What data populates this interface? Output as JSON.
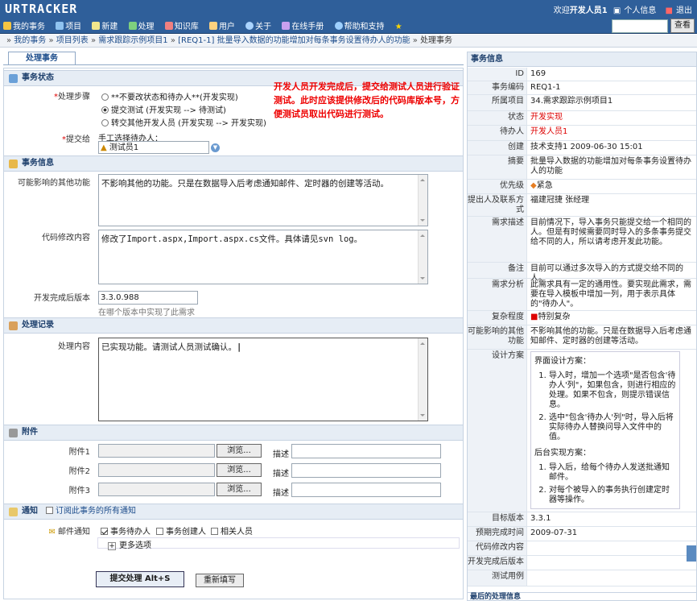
{
  "app": {
    "logo": "URTRACKER",
    "welcome_prefix": "欢迎",
    "user": "开发人员1",
    "profile": "个人信息",
    "logout": "退出",
    "search_button": "查看",
    "nav": [
      "我的事务",
      "项目",
      "新建",
      "处理",
      "知识库",
      "用户",
      "关于",
      "在线手册",
      "帮助和支持"
    ]
  },
  "breadcrumb": [
    "我的事务",
    "项目列表",
    "需求跟踪示例项目1",
    "[REQ1-1] 批量导入数据的功能增加对每条事务设置待办人的功能",
    "处理事务"
  ],
  "tab": "处理事务",
  "annotation": "开发人员开发完成后，提交给测试人员进行验证测试。此时应该提供修改后的代码库版本号，方便测试员取出代码进行测试。",
  "status_section": {
    "title": "事务状态",
    "step_label": "处理步骤",
    "options": [
      "**不要改状态和待办人**(开发实现)",
      "提交测试 (开发实现 --> 待测试)",
      "转交其他开发人员 (开发实现 --> 开发实现)"
    ],
    "submit_to_label": "提交给",
    "manual_pick": "手工选择待办人：",
    "assignee": "测试员1"
  },
  "info_section": {
    "title": "事务信息",
    "impact_label": "可能影响的其他功能",
    "impact_value": "不影响其他的功能。只是在数据导入后考虑通知邮件、定时器的创建等活动。",
    "code_label": "代码修改内容",
    "code_value": "修改了Import.aspx,Import.aspx.cs文件。具体请见svn log。",
    "version_label": "开发完成后版本",
    "version_value": "3.3.0.988",
    "version_hint": "在哪个版本中实现了此需求"
  },
  "record_section": {
    "title": "处理记录",
    "content_label": "处理内容",
    "content_value": "已实现功能。请测试人员测试确认。"
  },
  "attach_section": {
    "title": "附件",
    "rows": [
      {
        "label": "附件1",
        "browse": "浏览...",
        "desc": "描述"
      },
      {
        "label": "附件2",
        "browse": "浏览...",
        "desc": "描述"
      },
      {
        "label": "附件3",
        "browse": "浏览...",
        "desc": "描述"
      }
    ]
  },
  "notify_section": {
    "title": "通知",
    "subscribe": "订阅此事务的所有通知",
    "mail_label": "邮件通知",
    "checks": [
      {
        "label": "事务待办人",
        "checked": true
      },
      {
        "label": "事务创建人",
        "checked": false
      },
      {
        "label": "相关人员",
        "checked": false
      }
    ],
    "more": "更多选项"
  },
  "buttons": {
    "submit": "提交处理 Alt+S",
    "reset": "重新填写"
  },
  "info_panel": {
    "title": "事务信息",
    "rows": [
      {
        "k": "ID",
        "v": "169"
      },
      {
        "k": "事务编码",
        "v": "REQ1-1"
      },
      {
        "k": "所属项目",
        "v": "34.需求跟踪示例项目1"
      },
      {
        "k": "状态",
        "v": "开发实现"
      },
      {
        "k": "待办人",
        "v": "开发人员1"
      },
      {
        "k": "创建",
        "v": "技术支持1 2009-06-30 15:01"
      },
      {
        "k": "摘要",
        "v": "批量导入数据的功能增加对每条事务设置待办人的功能"
      },
      {
        "k": "优先级",
        "v": "紧急"
      },
      {
        "k": "提出人及联系方式",
        "v": "福建冠捷 张经理"
      },
      {
        "k": "需求描述",
        "v": "目前情况下，导入事务只能提交给一个相同的人。但是有时候需要同时导入的多条事务提交给不同的人，所以请考虑开发此功能。"
      },
      {
        "k": "备注",
        "v": "目前可以通过多次导入的方式提交给不同的人。"
      },
      {
        "k": "需求分析",
        "v": "此需求具有一定的通用性。要实现此需求，需要在导入模板中增加一列，用于表示具体的\"待办人\"。"
      },
      {
        "k": "复杂程度",
        "v": "特别复杂"
      },
      {
        "k": "可能影响的其他功能",
        "v": "不影响其他的功能。只是在数据导入后考虑通知邮件、定时器的创建等活动。"
      },
      {
        "k": "设计方案",
        "v": ""
      },
      {
        "k": "目标版本",
        "v": "3.3.1"
      },
      {
        "k": "预期完成时间",
        "v": "2009-07-31"
      },
      {
        "k": "代码修改内容",
        "v": ""
      },
      {
        "k": "开发完成后版本",
        "v": ""
      },
      {
        "k": "测试用例",
        "v": ""
      }
    ],
    "design": {
      "ui_title": "界面设计方案：",
      "ui_items": [
        "导入时，增加一个选项\"是否包含'待办人'列\"，如果包含，则进行相应的处理。如果不包含，则提示错误信息。",
        "选中\"包含'待办人'列\"时，导入后将实际待办人替换问导入文件中的值。"
      ],
      "backend_title": "后台实现方案：",
      "backend_items": [
        "导入后，给每个待办人发送批通知邮件。",
        "对每个被导入的事务执行创建定时器等操作。"
      ]
    }
  },
  "last_record_title": "最后的处理信息"
}
